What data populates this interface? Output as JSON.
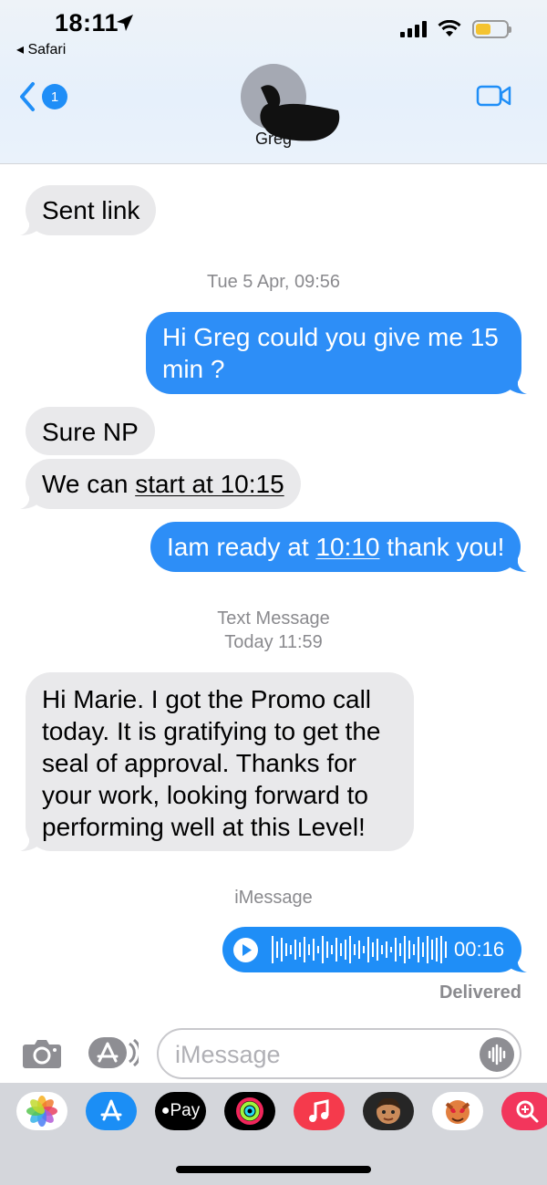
{
  "status": {
    "time": "18:11",
    "back_app": "◂ Safari"
  },
  "nav": {
    "unread_count": "1",
    "contact_name": "Greg"
  },
  "messages": [
    {
      "dir": "in",
      "text": "Sent link"
    },
    {
      "dir": "out",
      "text": "Hi Greg could you give me 15 min ?"
    },
    {
      "dir": "in",
      "text": "Sure NP"
    },
    {
      "dir": "in",
      "pre": "We can ",
      "link": "start at 10:15"
    },
    {
      "dir": "out",
      "pre": "Iam ready at ",
      "link": "10:10",
      "post": " thank you!"
    },
    {
      "dir": "in",
      "text": "Hi Marie. I got the Promo call today. It is gratifying to get the seal of approval. Thanks for your work, looking forward to performing well at this Level!"
    }
  ],
  "timestamps": {
    "first": "Tue 5 Apr, 09:56",
    "sms_label": "Text Message",
    "sms_time": "Today 11:59",
    "imessage_label": "iMessage"
  },
  "voice_message": {
    "duration": "00:16"
  },
  "delivery_status": "Delivered",
  "composer": {
    "placeholder": "iMessage"
  },
  "colors": {
    "outgoing": "#2d8ef7",
    "incoming": "#e9e9eb",
    "accent": "#1f8ef7"
  },
  "app_drawer": [
    {
      "name": "photos-icon"
    },
    {
      "name": "app-store-icon"
    },
    {
      "name": "apple-pay-icon",
      "label": "Pay"
    },
    {
      "name": "activity-icon"
    },
    {
      "name": "music-icon"
    },
    {
      "name": "memoji-icon"
    },
    {
      "name": "animoji-icon"
    },
    {
      "name": "web-search-icon"
    }
  ]
}
